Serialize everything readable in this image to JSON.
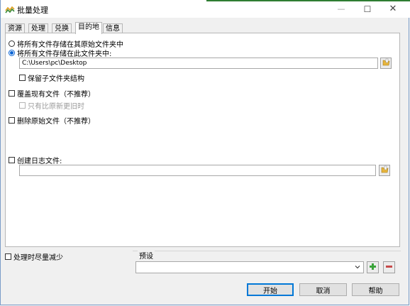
{
  "window": {
    "title": "批量处理",
    "minimize_label": "—",
    "maximize_label": "☐",
    "close_label": "✕"
  },
  "tabs": [
    {
      "label": "资源"
    },
    {
      "label": "处理"
    },
    {
      "label": "兑换"
    },
    {
      "label": "目的地"
    },
    {
      "label": "信息"
    }
  ],
  "destination": {
    "option_original": "将所有文件存储在其原始文件夹中",
    "option_this_folder": "将所有文件存储在此文件夹中:",
    "folder_path": "C:\\Users\\pc\\Desktop",
    "keep_subfolders": "保留子文件夹结构",
    "overwrite": "覆盖现有文件（不推荐）",
    "only_if_newer": "只有比原新更旧时",
    "delete_originals": "删除原始文件（不推荐）",
    "create_log": "创建日志文件:",
    "log_path": ""
  },
  "footer": {
    "minimize_while_processing": "处理时尽量减少",
    "preset_label": "预设",
    "preset_value": "",
    "start": "开始",
    "cancel": "取消",
    "help": "帮助"
  },
  "colors": {
    "accent": "#0078d7",
    "radio_selected": "#0a64d4",
    "add_green": "#3aa33a",
    "remove_red": "#c74a4a",
    "folder_yellow": "#e7b53c"
  },
  "icons": {
    "app": "batch-process-icon",
    "folder": "folder-icon",
    "dropdown": "chevron-down-icon",
    "add": "plus-icon",
    "remove": "minus-icon"
  }
}
